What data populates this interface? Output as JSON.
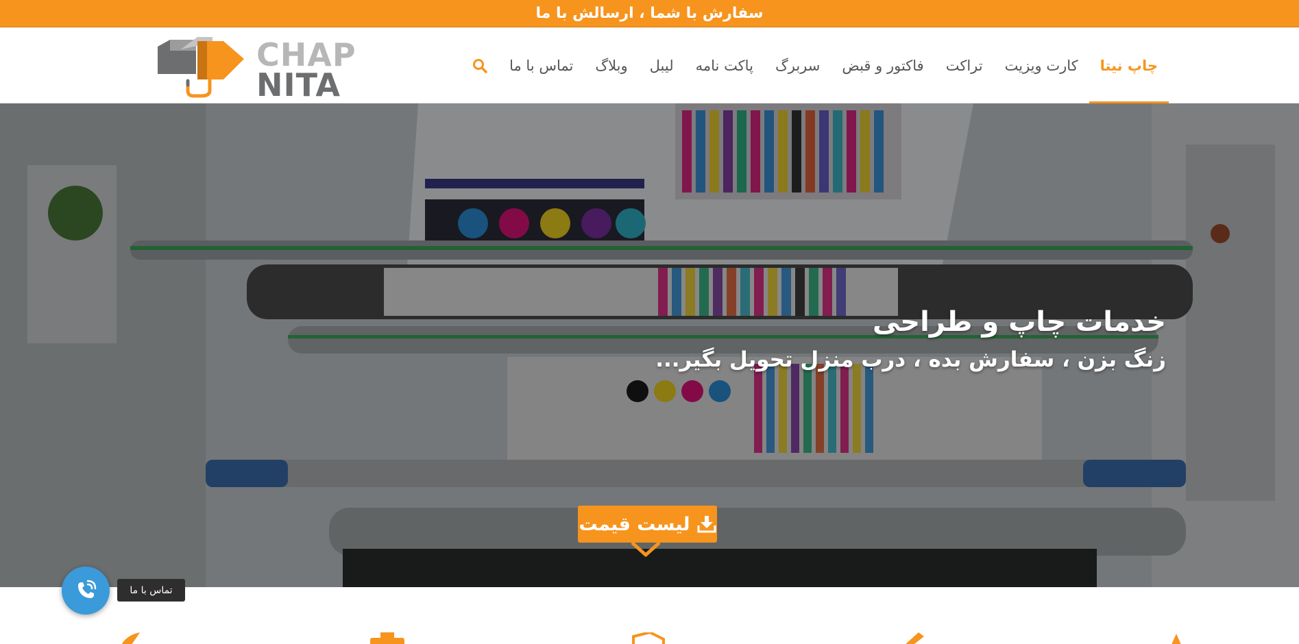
{
  "topbar": {
    "text": "سفارش با شما ، ارسالش با ما"
  },
  "brand": {
    "line1": "CHAP",
    "line2": "NITA"
  },
  "nav": {
    "items": [
      {
        "label": "چاپ نیتا"
      },
      {
        "label": "کارت ویزیت"
      },
      {
        "label": "تراکت"
      },
      {
        "label": "فاکتور و قبض"
      },
      {
        "label": "سربرگ"
      },
      {
        "label": "پاکت نامه"
      },
      {
        "label": "لیبل"
      },
      {
        "label": "وبلاگ"
      },
      {
        "label": "تماس با ما"
      }
    ],
    "active_index": 0,
    "search_icon": "search-icon"
  },
  "hero": {
    "title": "خدمات چاپ و طراحی",
    "subtitle": "زنگ بزن ، سفارش بده ، درب منزل تحویل بگیر...",
    "button_label": "لیست قیمت",
    "button_icon": "download-icon"
  },
  "contact_widget": {
    "label": "تماس با ما",
    "icon": "phone-icon",
    "color": "#3b9ad9"
  },
  "colors": {
    "accent": "#f7941d",
    "nav_text": "#555555",
    "logo_light": "#b7b7b7",
    "logo_dark": "#6d6e70"
  }
}
